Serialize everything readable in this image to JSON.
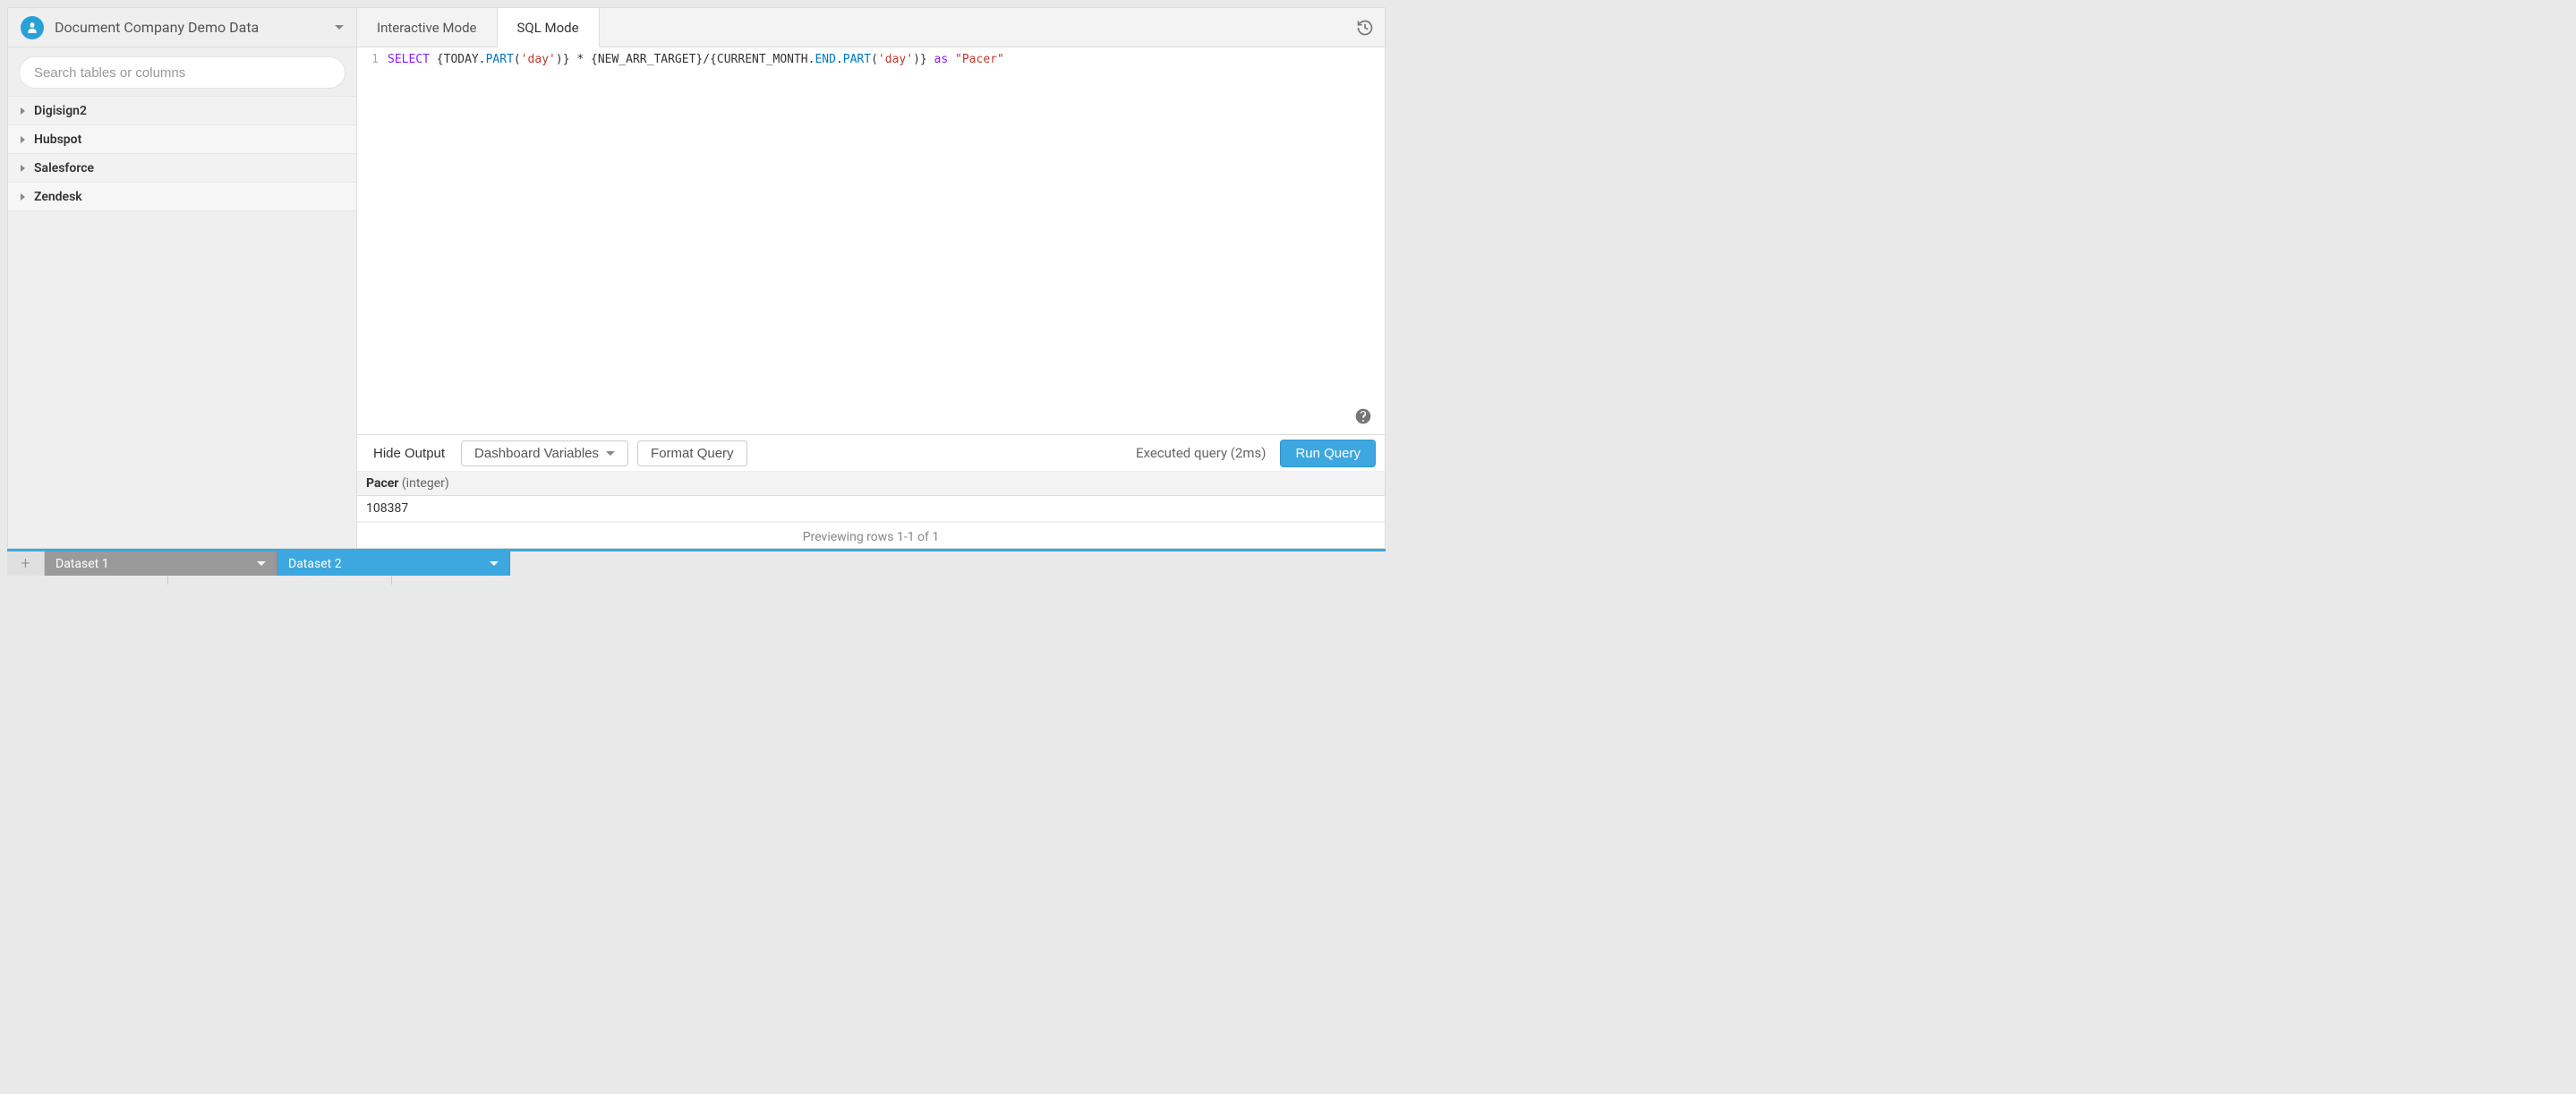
{
  "sidebar": {
    "datasource_title": "Document Company Demo Data",
    "search_placeholder": "Search tables or columns",
    "tables": [
      {
        "label": "Digisign2"
      },
      {
        "label": "Hubspot"
      },
      {
        "label": "Salesforce"
      },
      {
        "label": "Zendesk"
      }
    ]
  },
  "tabs": {
    "interactive": "Interactive Mode",
    "sql": "SQL Mode"
  },
  "editor": {
    "line_no": "1",
    "sql": {
      "kw_select": "SELECT",
      "seg1": " {TODAY.",
      "func1": "PART",
      "seg2": "(",
      "str1": "'day'",
      "seg3": ")} * {NEW_ARR_TARGET}/{CURRENT_MONTH.",
      "prop_end": "END",
      "dot": ".",
      "func2": "PART",
      "seg4": "(",
      "str2": "'day'",
      "seg5": ")} ",
      "kw_as": "as",
      "seg6": " ",
      "alias": "\"Pacer\""
    }
  },
  "toolbar": {
    "hide_output": "Hide Output",
    "dashboard_vars": "Dashboard Variables",
    "format_query": "Format Query",
    "exec_status": "Executed query (2ms)",
    "run_query": "Run Query"
  },
  "results": {
    "column_name": "Pacer",
    "column_type": " (integer)",
    "row_value": "108387",
    "preview_text": "Previewing rows 1-1 of 1"
  },
  "bottom_tabs": {
    "dataset1": "Dataset 1",
    "dataset2": "Dataset 2"
  }
}
